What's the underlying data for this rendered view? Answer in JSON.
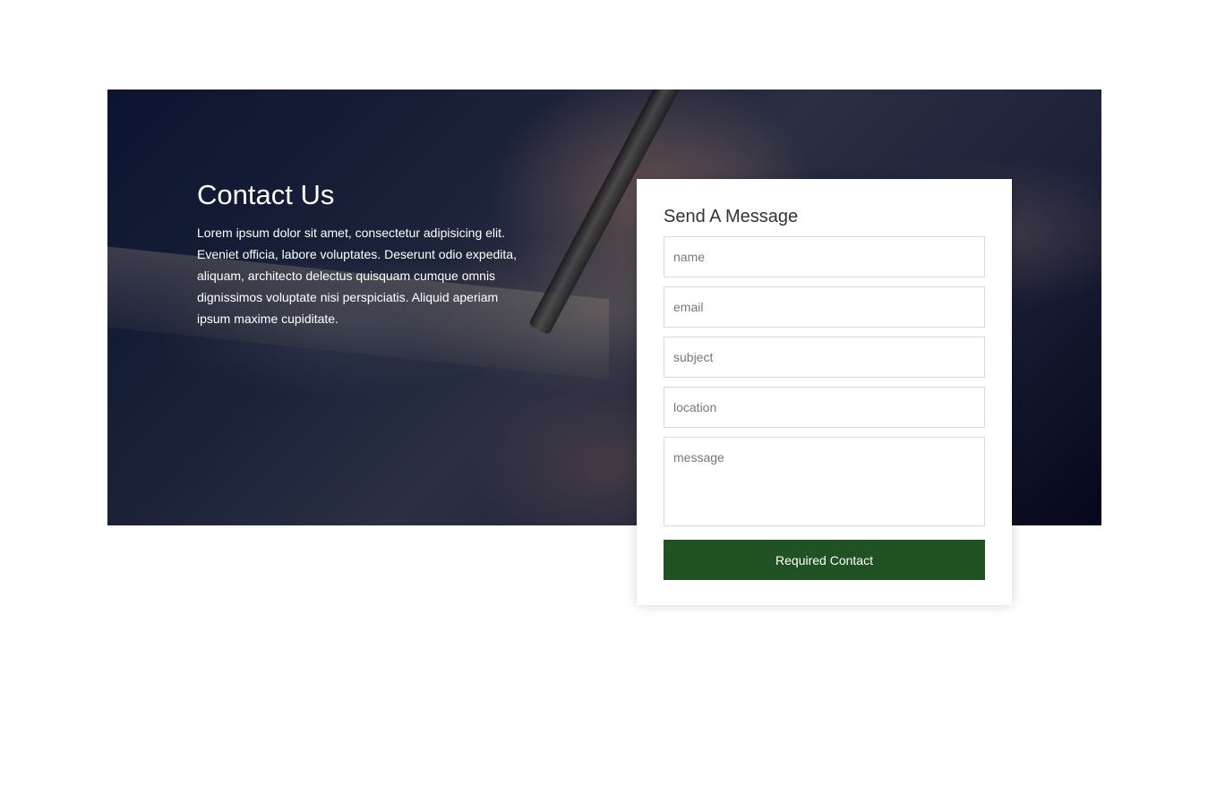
{
  "hero": {
    "title": "Contact Us",
    "description": "Lorem ipsum dolor sit amet, consectetur adipisicing elit. Eveniet officia, labore voluptates. Deserunt odio expedita, aliquam, architecto delectus quisquam cumque omnis dignissimos voluptate nisi perspiciatis. Aliquid aperiam ipsum maxime cupiditate."
  },
  "form": {
    "title": "Send A Message",
    "fields": {
      "name_placeholder": "name",
      "email_placeholder": "email",
      "subject_placeholder": "subject",
      "location_placeholder": "location",
      "message_placeholder": "message"
    },
    "submit_label": "Required Contact"
  },
  "colors": {
    "button_bg": "#215223",
    "button_text": "#ffffff",
    "card_bg": "#ffffff"
  }
}
